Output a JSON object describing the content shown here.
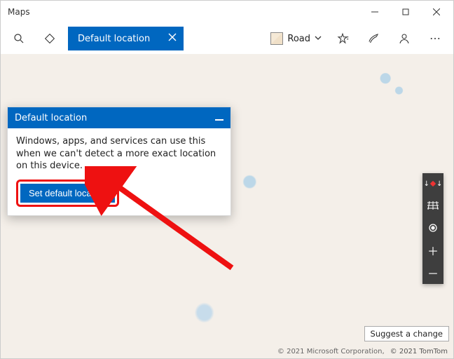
{
  "app": {
    "title": "Maps"
  },
  "toolbar": {
    "pill_label": "Default location",
    "view_label": "Road"
  },
  "panel": {
    "title": "Default location",
    "description": "Windows, apps, and services can use this when we can't detect a more exact location on this device.",
    "button": "Set default location"
  },
  "suggest_label": "Suggest a change",
  "copyright": {
    "ms": "© 2021 Microsoft Corporation,",
    "tomtom": "© 2021 TomTom"
  }
}
